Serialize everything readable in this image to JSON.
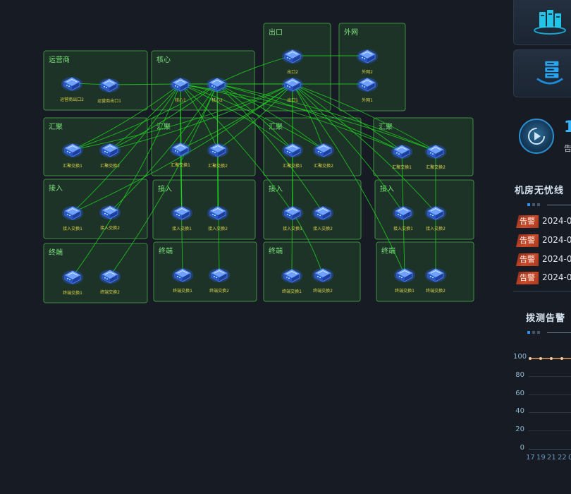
{
  "topology": {
    "zones": [
      {
        "id": "z1",
        "label": "运营商",
        "devices": [
          {
            "id": "d1",
            "label": "运营商出口2"
          },
          {
            "id": "d2",
            "label": "运营商出口1"
          }
        ]
      },
      {
        "id": "z2",
        "label": "核心",
        "devices": [
          {
            "id": "d3",
            "label": "核心1"
          },
          {
            "id": "d4",
            "label": "核心2"
          }
        ]
      },
      {
        "id": "z3",
        "label": "出口",
        "devices": [
          {
            "id": "d5",
            "label": "出口2"
          },
          {
            "id": "d6",
            "label": "出口1"
          }
        ]
      },
      {
        "id": "z4",
        "label": "外网",
        "devices": [
          {
            "id": "d7",
            "label": "外网2"
          },
          {
            "id": "d8",
            "label": "外网1"
          }
        ]
      },
      {
        "id": "z5",
        "label": "汇聚",
        "devices": [
          {
            "id": "d9",
            "label": "汇聚交换1"
          },
          {
            "id": "d10",
            "label": "汇聚交换2"
          }
        ]
      },
      {
        "id": "z6",
        "label": "汇聚",
        "devices": [
          {
            "id": "d11",
            "label": "汇聚交换1"
          },
          {
            "id": "d12",
            "label": "汇聚交换2"
          }
        ]
      },
      {
        "id": "z7",
        "label": "汇聚",
        "devices": [
          {
            "id": "d13",
            "label": "汇聚交换1"
          },
          {
            "id": "d14",
            "label": "汇聚交换2"
          }
        ]
      },
      {
        "id": "z8",
        "label": "汇聚",
        "devices": [
          {
            "id": "d15",
            "label": "汇聚交换1"
          },
          {
            "id": "d16",
            "label": "汇聚交换2"
          }
        ]
      },
      {
        "id": "z9",
        "label": "接入",
        "devices": [
          {
            "id": "d17",
            "label": "接入交换1"
          },
          {
            "id": "d18",
            "label": "接入交换2"
          }
        ]
      },
      {
        "id": "z10",
        "label": "接入",
        "devices": [
          {
            "id": "d19",
            "label": "接入交换1"
          },
          {
            "id": "d20",
            "label": "接入交换2"
          }
        ]
      },
      {
        "id": "z11",
        "label": "接入",
        "devices": [
          {
            "id": "d21",
            "label": "接入交换1"
          },
          {
            "id": "d22",
            "label": "接入交换2"
          }
        ]
      },
      {
        "id": "z12",
        "label": "接入",
        "devices": [
          {
            "id": "d23",
            "label": "接入交换1"
          },
          {
            "id": "d24",
            "label": "接入交换2"
          }
        ]
      },
      {
        "id": "z13",
        "label": "终端",
        "devices": [
          {
            "id": "d25",
            "label": "终端交换1"
          },
          {
            "id": "d26",
            "label": "终端交换2"
          }
        ]
      },
      {
        "id": "z14",
        "label": "终端",
        "devices": [
          {
            "id": "d27",
            "label": "终端交换1"
          },
          {
            "id": "d28",
            "label": "终端交换2"
          }
        ]
      },
      {
        "id": "z15",
        "label": "终端",
        "devices": [
          {
            "id": "d29",
            "label": "终端交换1"
          },
          {
            "id": "d30",
            "label": "终端交换2"
          }
        ]
      },
      {
        "id": "z16",
        "label": "终端",
        "devices": [
          {
            "id": "d31",
            "label": "终端交换1"
          },
          {
            "id": "d32",
            "label": "终端交换2"
          }
        ]
      }
    ],
    "links": [
      [
        "d1",
        "d2"
      ],
      [
        "d2",
        "d3"
      ],
      [
        "d3",
        "d4"
      ],
      [
        "d3",
        "d6"
      ],
      [
        "d4",
        "d6"
      ],
      [
        "d4",
        "d5"
      ],
      [
        "d5",
        "d7"
      ],
      [
        "d6",
        "d8"
      ],
      [
        "d3",
        "d9"
      ],
      [
        "d3",
        "d10"
      ],
      [
        "d3",
        "d11"
      ],
      [
        "d3",
        "d12"
      ],
      [
        "d3",
        "d13"
      ],
      [
        "d3",
        "d14"
      ],
      [
        "d3",
        "d15"
      ],
      [
        "d3",
        "d16"
      ],
      [
        "d4",
        "d9"
      ],
      [
        "d4",
        "d10"
      ],
      [
        "d4",
        "d11"
      ],
      [
        "d4",
        "d12"
      ],
      [
        "d4",
        "d13"
      ],
      [
        "d4",
        "d14"
      ],
      [
        "d4",
        "d15"
      ],
      [
        "d4",
        "d16"
      ],
      [
        "d6",
        "d9"
      ],
      [
        "d6",
        "d10"
      ],
      [
        "d6",
        "d11"
      ],
      [
        "d6",
        "d12"
      ],
      [
        "d6",
        "d13"
      ],
      [
        "d6",
        "d14"
      ],
      [
        "d6",
        "d15"
      ],
      [
        "d6",
        "d16"
      ],
      [
        "d3",
        "d17"
      ],
      [
        "d3",
        "d19"
      ],
      [
        "d3",
        "d21"
      ],
      [
        "d4",
        "d18"
      ],
      [
        "d4",
        "d20"
      ],
      [
        "d4",
        "d22"
      ],
      [
        "d6",
        "d17"
      ],
      [
        "d6",
        "d23"
      ],
      [
        "d6",
        "d24"
      ],
      [
        "d6",
        "d21"
      ],
      [
        "d11",
        "d19"
      ],
      [
        "d12",
        "d20"
      ],
      [
        "d11",
        "d27"
      ],
      [
        "d12",
        "d28"
      ],
      [
        "d13",
        "d21"
      ],
      [
        "d13",
        "d29"
      ],
      [
        "d3",
        "d25"
      ],
      [
        "d4",
        "d26"
      ],
      [
        "d21",
        "d30"
      ],
      [
        "d6",
        "d31"
      ],
      [
        "d15",
        "d31"
      ],
      [
        "d16",
        "d32"
      ]
    ]
  },
  "panel": {
    "stat_value": "1",
    "stat_label": "告",
    "room_alarm_title": "机房无忧线",
    "alarms": [
      {
        "tag": "告警",
        "time": "2024-0"
      },
      {
        "tag": "告警",
        "time": "2024-0"
      },
      {
        "tag": "告警",
        "time": "2024-0"
      },
      {
        "tag": "告警",
        "time": "2024-0"
      }
    ],
    "probe_title": "拨测告警",
    "chart_data": {
      "type": "line",
      "y_ticks": [
        "100",
        "80",
        "60",
        "40",
        "20",
        "0"
      ],
      "x_ticks": [
        "17",
        "19",
        "21",
        "22",
        "0"
      ],
      "ylim": [
        0,
        100
      ],
      "series": [
        {
          "values": [
            100,
            100,
            100,
            100,
            100
          ]
        }
      ],
      "grid": true
    }
  },
  "colors": {
    "background": "#171c24",
    "zone_fill": "#285a2d",
    "zone_stroke": "#3f8f3f",
    "link": "#1fd41f",
    "device_label": "#d9d24a",
    "accent_blue": "#37b4ff",
    "alarm_tag": "#c94a2a",
    "chart_line": "#e8a060"
  },
  "icons": {
    "device": "router-icon",
    "server_card": "server-rack-icon",
    "storage_card": "server-stack-icon",
    "stat": "play-circle-icon"
  }
}
